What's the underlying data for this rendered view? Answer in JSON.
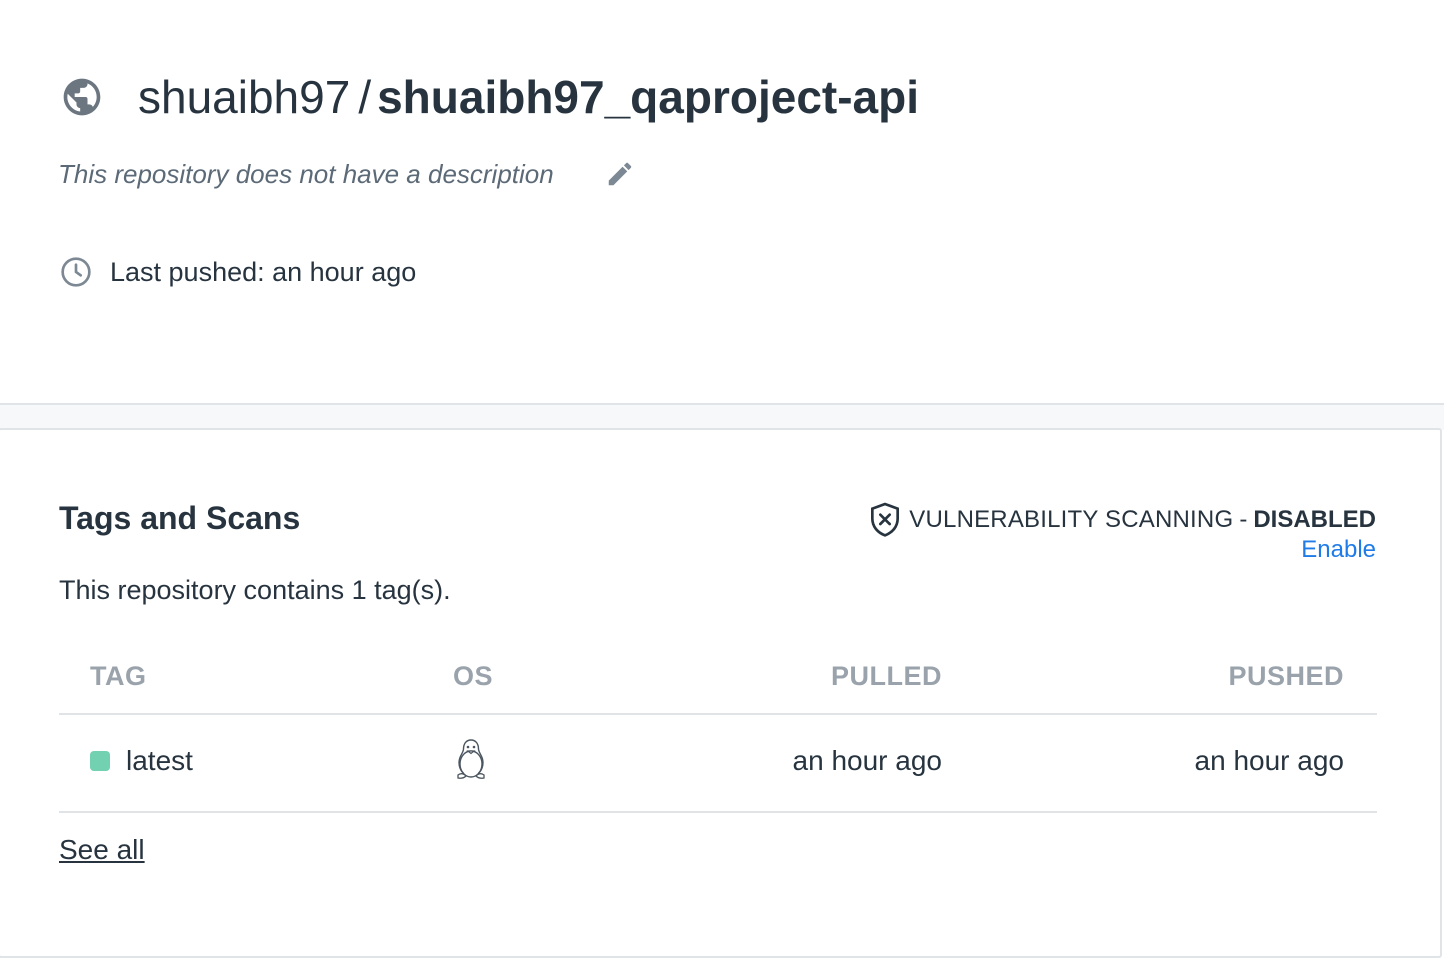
{
  "header": {
    "visibility_icon": "globe-icon",
    "namespace": "shuaibh97",
    "separator": "/",
    "repo_name": "shuaibh97_qaproject-api",
    "description": "This repository does not have a description",
    "edit_icon": "pencil-icon",
    "last_pushed": "Last pushed: an hour ago",
    "clock_icon": "clock-icon"
  },
  "tags_card": {
    "title": "Tags and Scans",
    "vulnerability": {
      "icon": "shield-x-icon",
      "label": "VULNERABILITY SCANNING",
      "dash": "-",
      "status": "DISABLED",
      "enable_label": "Enable"
    },
    "tag_count_text": "This repository contains 1 tag(s).",
    "columns": [
      "TAG",
      "OS",
      "PULLED",
      "PUSHED"
    ],
    "rows": [
      {
        "tag": "latest",
        "os_icon": "linux-penguin-icon",
        "pulled": "an hour ago",
        "pushed": "an hour ago"
      }
    ],
    "see_all_label": "See all"
  },
  "colors": {
    "text": "#27343f",
    "muted": "#9aa3ab",
    "link": "#1f7be8",
    "tag_dot": "#72d1b1",
    "border": "#e1e4e7"
  }
}
